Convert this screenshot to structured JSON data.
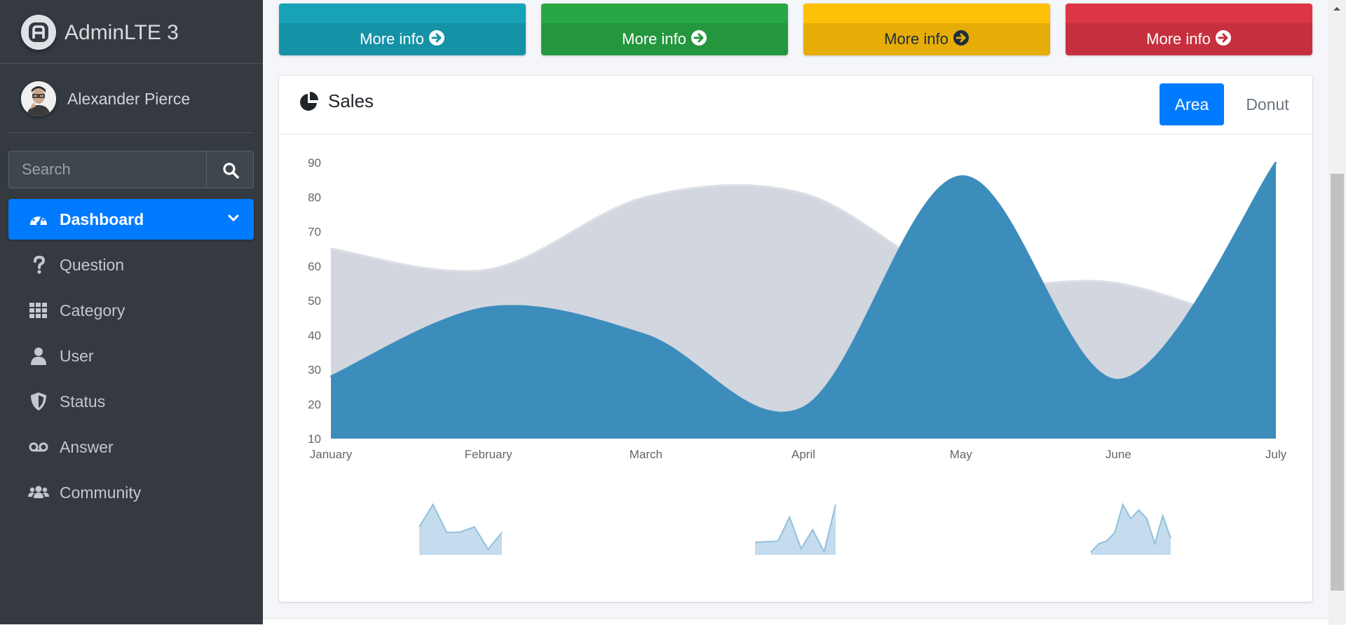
{
  "brand": {
    "name": "AdminLTE 3",
    "logo_icon": "adminlte-logo-icon"
  },
  "user": {
    "name": "Alexander Pierce"
  },
  "search": {
    "placeholder": "Search",
    "value": ""
  },
  "nav": [
    {
      "label": "Dashboard",
      "icon": "tachometer-icon",
      "active": true
    },
    {
      "label": "Question",
      "icon": "question-icon"
    },
    {
      "label": "Category",
      "icon": "grid-icon"
    },
    {
      "label": "User",
      "icon": "user-icon"
    },
    {
      "label": "Status",
      "icon": "shield-icon"
    },
    {
      "label": "Answer",
      "icon": "voicemail-icon"
    },
    {
      "label": "Community",
      "icon": "users-icon"
    }
  ],
  "boxes": [
    {
      "footer": "More info",
      "color": "#17a2b8",
      "footer_color": "#1592a6",
      "text_color": "#ffffff"
    },
    {
      "footer": "More info",
      "color": "#28a745",
      "footer_color": "#24963e",
      "text_color": "#ffffff"
    },
    {
      "footer": "More info",
      "color": "#ffc107",
      "footer_color": "#e6ad06",
      "text_color": "#1f2d3d"
    },
    {
      "footer": "More info",
      "color": "#dc3545",
      "footer_color": "#c6303e",
      "text_color": "#ffffff"
    }
  ],
  "card": {
    "title": "Sales",
    "title_icon": "chart-pie-icon",
    "tabs": [
      {
        "label": "Area",
        "active": true
      },
      {
        "label": "Donut",
        "active": false
      }
    ]
  },
  "chart_data": {
    "type": "area",
    "categories": [
      "January",
      "February",
      "March",
      "April",
      "May",
      "June",
      "July"
    ],
    "series": [
      {
        "values": [
          65,
          59,
          80,
          81,
          56,
          55,
          40
        ],
        "color": "#d2d6de"
      },
      {
        "values": [
          28,
          48,
          40,
          19,
          86,
          27,
          90
        ],
        "color": "#3c8dbc"
      }
    ],
    "ylim": [
      10,
      90
    ],
    "yticks": [
      10,
      20,
      30,
      40,
      50,
      60,
      70,
      80,
      90
    ],
    "grid": false
  },
  "sparklines": [
    {
      "values": [
        5,
        9,
        4,
        4.1,
        5,
        1,
        4
      ],
      "color": "#92c1dc"
    },
    {
      "values": [
        2,
        2.1,
        2.2,
        6,
        1,
        4,
        0.5,
        8
      ],
      "color": "#92c1dc"
    },
    {
      "values": [
        0.5,
        2,
        2.5,
        4,
        9,
        6.5,
        8,
        6.5,
        2,
        7,
        3
      ],
      "color": "#92c1dc"
    }
  ]
}
